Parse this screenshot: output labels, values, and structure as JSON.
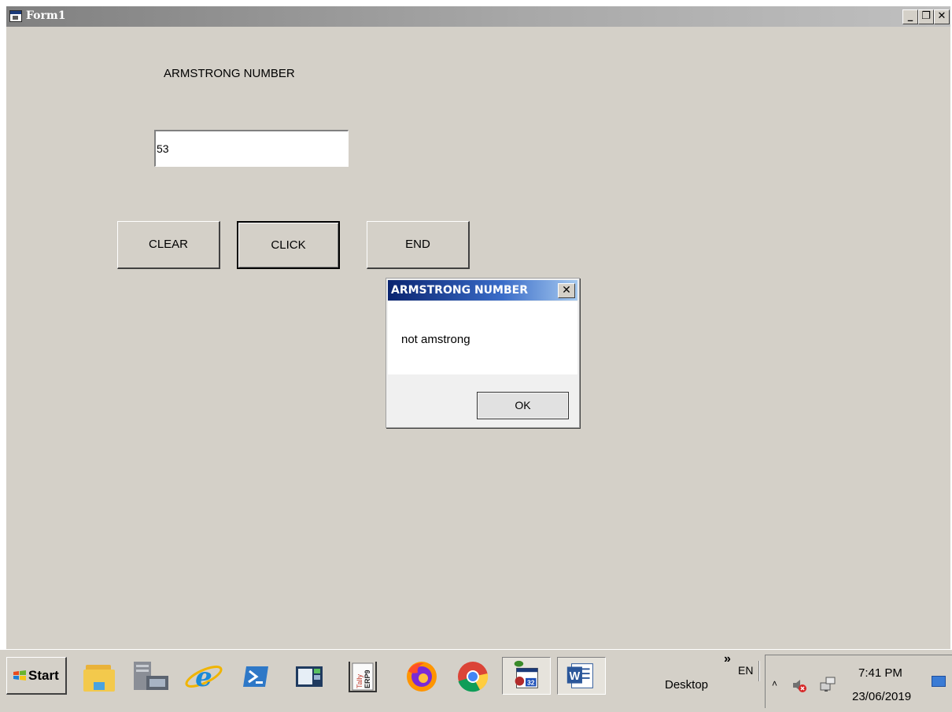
{
  "window": {
    "title": "Form1",
    "controls": {
      "minimize": "_",
      "restore": "❐",
      "close": "✕"
    }
  },
  "form": {
    "label": "ARMSTRONG NUMBER",
    "input_value": "53",
    "buttons": {
      "clear": "CLEAR",
      "click": "CLICK",
      "end": "END"
    }
  },
  "message_box": {
    "title": "ARMSTRONG NUMBER",
    "close": "✕",
    "text": "not amstrong",
    "ok": "OK"
  },
  "taskbar": {
    "start": "Start",
    "pinned": [
      "file-explorer-icon",
      "server-manager-icon",
      "internet-explorer-icon",
      "powershell-icon",
      "app-window-icon",
      "tally-erp9-icon",
      "firefox-icon",
      "chrome-icon",
      "vb-project-icon",
      "word-icon"
    ],
    "tally_text": "Tally",
    "erp_text": "ERP9",
    "vb_badge": "32",
    "word_text": "W",
    "desktop": "Desktop",
    "chevron": "»",
    "language": "EN",
    "tray_up": "˄",
    "time": "7:41 PM",
    "date": "23/06/2019"
  }
}
